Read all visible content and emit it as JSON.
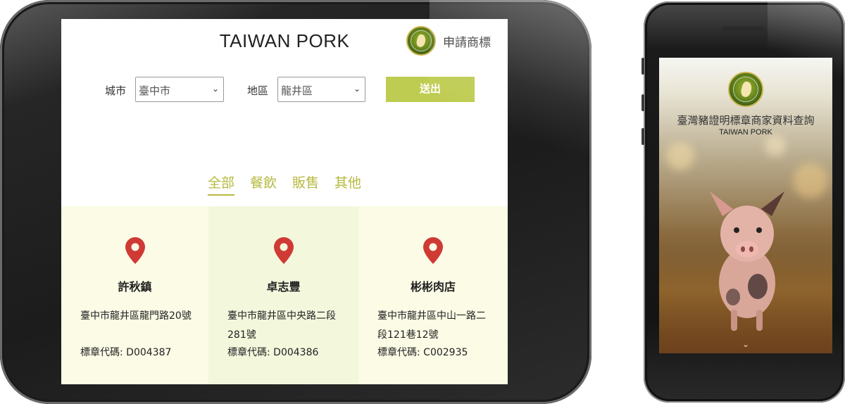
{
  "site": {
    "title": "TAIWAN PORK",
    "apply_link": "申請商標"
  },
  "filters": {
    "city_label": "城市",
    "city_value": "臺中市",
    "district_label": "地區",
    "district_value": "龍井區",
    "submit_label": "送出"
  },
  "tabs": [
    {
      "label": "全部",
      "active": true
    },
    {
      "label": "餐飲",
      "active": false
    },
    {
      "label": "販售",
      "active": false
    },
    {
      "label": "其他",
      "active": false
    }
  ],
  "stores": [
    {
      "name": "許秋鎮",
      "address": "臺中市龍井區龍門路20號",
      "code": "標章代碼: D004387"
    },
    {
      "name": "卓志豐",
      "address": "臺中市龍井區中央路二段281號",
      "code": "標章代碼: D004386"
    },
    {
      "name": "彬彬肉店",
      "address": "臺中市龍井區中山一路二段121巷12號",
      "code": "標章代碼: C002935"
    }
  ],
  "mobile": {
    "title": "臺灣豬證明標章商家資料查詢",
    "subtitle": "TAIWAN PORK"
  },
  "colors": {
    "accent": "#b6b93f",
    "button": "#bfcc52",
    "pin": "#cf3a35",
    "card_light": "#fbfbe6",
    "card_mid": "#f3f7dc"
  },
  "icons": {
    "logo": "taiwan-pig-logo",
    "pin": "map-pin-icon",
    "chevron": "chevron-down-icon"
  }
}
